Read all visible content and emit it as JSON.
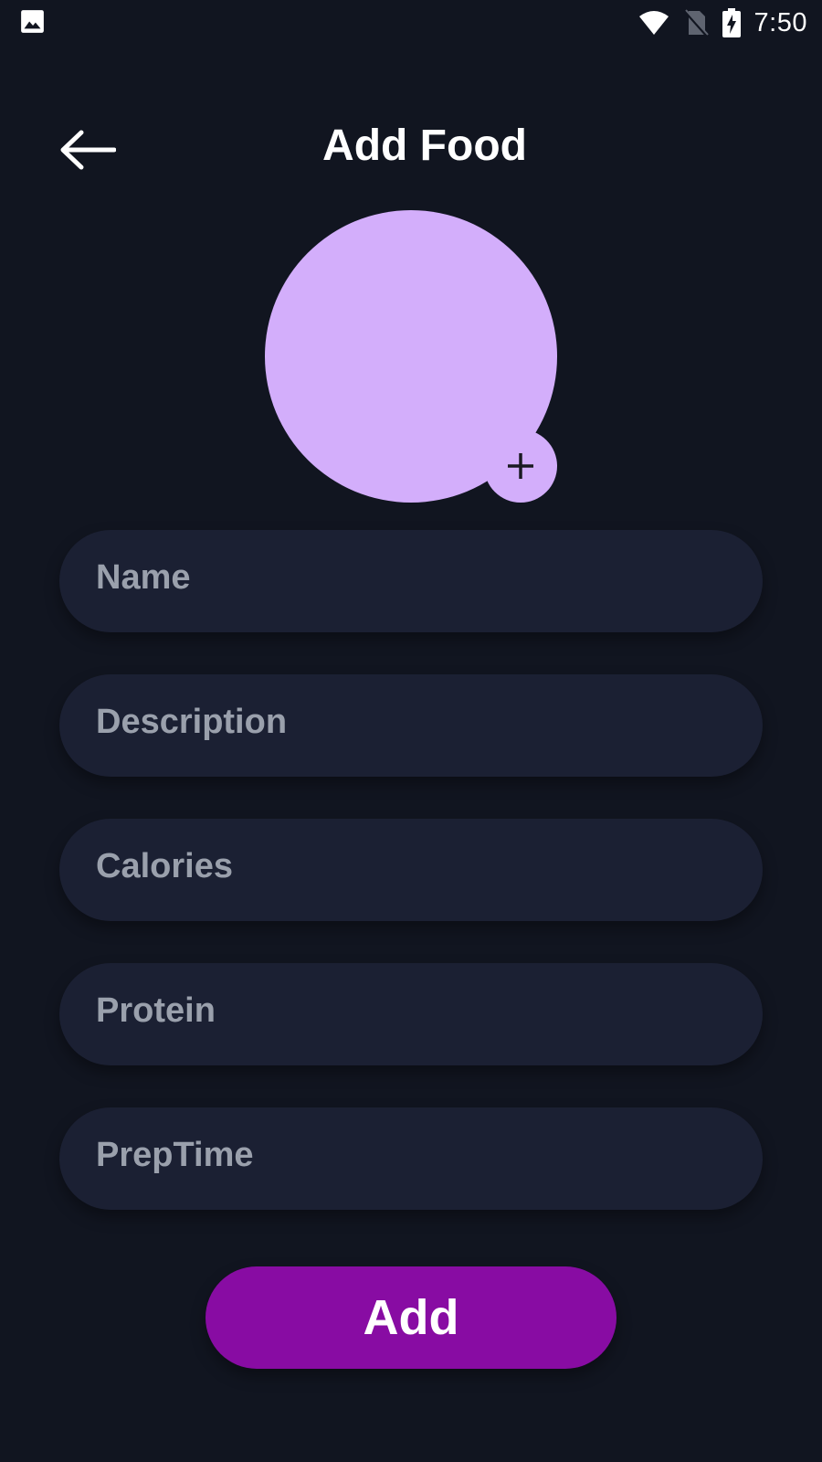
{
  "status_bar": {
    "time": "7:50",
    "icons": [
      "gallery-icon",
      "wifi-icon",
      "no-sim-icon",
      "battery-charging-icon"
    ]
  },
  "header": {
    "title": "Add Food",
    "back_icon": "arrow-left-icon"
  },
  "image_picker": {
    "color": "#d3aefb",
    "add_icon": "plus-icon"
  },
  "form": {
    "name_placeholder": "Name",
    "description_placeholder": "Description",
    "calories_placeholder": "Calories",
    "protein_placeholder": "Protein",
    "preptime_placeholder": "PrepTime"
  },
  "actions": {
    "add_label": "Add"
  },
  "colors": {
    "background": "#111520",
    "field": "#1b2033",
    "accent": "#880ca3",
    "avatar": "#d3aefb"
  }
}
